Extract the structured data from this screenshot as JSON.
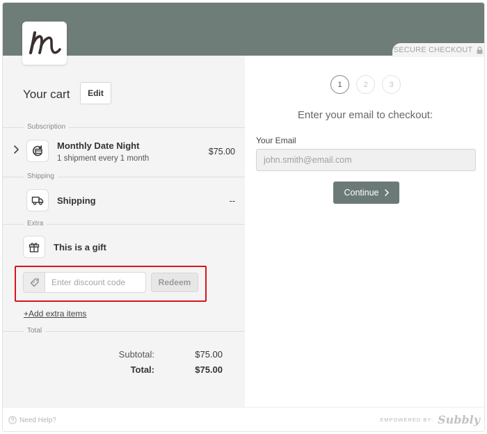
{
  "header": {
    "secure_label": "SECURE CHECKOUT",
    "logo_icon": "signature-logo-icon",
    "lock_icon": "lock-icon"
  },
  "cart": {
    "title": "Your cart",
    "edit_label": "Edit",
    "sections": {
      "subscription": "Subscription",
      "shipping": "Shipping",
      "extra": "Extra",
      "total": "Total"
    },
    "subscription_item": {
      "name": "Monthly Date Night",
      "schedule": "1 shipment every 1 month",
      "price": "$75.00",
      "icon": "subscription-box-icon"
    },
    "shipping_item": {
      "name": "Shipping",
      "price": "--",
      "icon": "truck-icon"
    },
    "gift_item": {
      "label": "This is a gift",
      "icon": "gift-icon"
    },
    "discount": {
      "placeholder": "Enter discount code",
      "value": "",
      "redeem_label": "Redeem",
      "icon": "tag-icon"
    },
    "add_extra_label": "+Add extra items",
    "summary": {
      "subtotal_label": "Subtotal:",
      "subtotal_value": "$75.00",
      "total_label": "Total:",
      "total_value": "$75.00"
    }
  },
  "checkout": {
    "steps": [
      "1",
      "2",
      "3"
    ],
    "active_step": 1,
    "prompt": "Enter your email to checkout:",
    "email_label": "Your Email",
    "email_placeholder": "john.smith@email.com",
    "email_value": "",
    "continue_label": "Continue"
  },
  "footer": {
    "help_label": "Need Help?",
    "powered_label": "EMPOWERED BY:",
    "brand": "Subbly"
  },
  "colors": {
    "header_bg": "#6e7d78",
    "button_primary": "#6b7a76",
    "highlight": "#d9141b"
  }
}
